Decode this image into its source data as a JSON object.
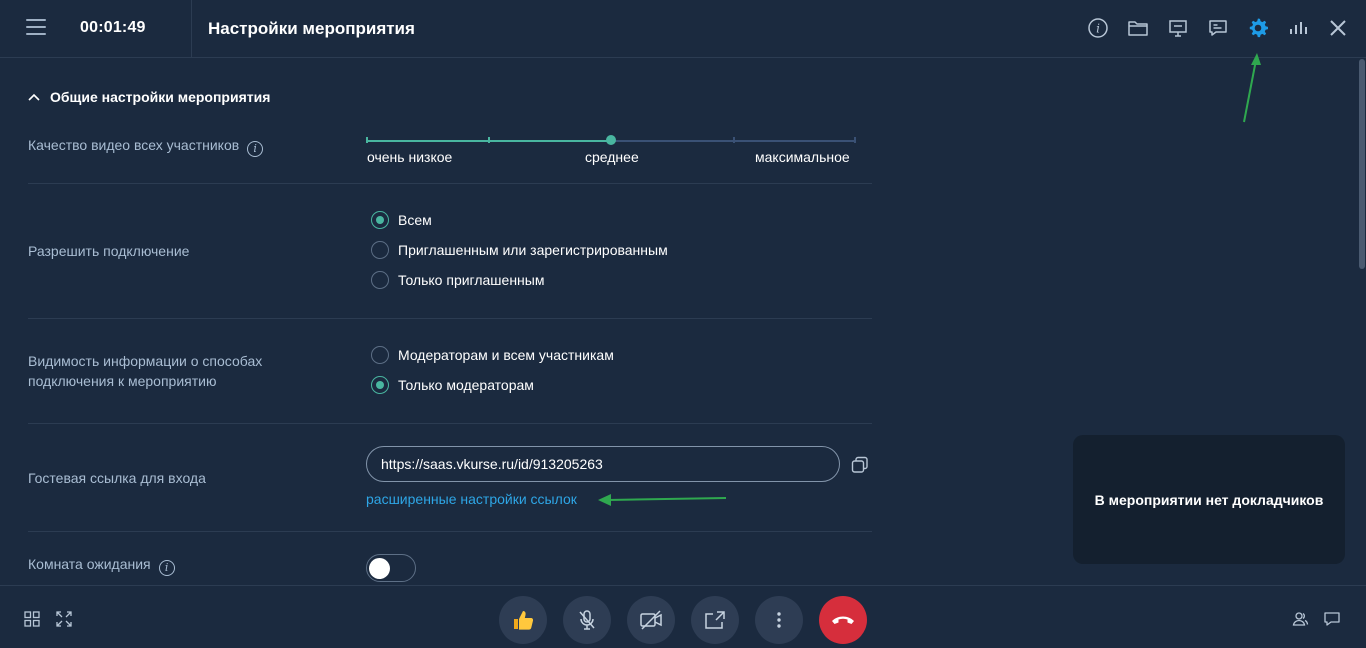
{
  "header": {
    "timer": "00:01:49",
    "title": "Настройки мероприятия",
    "tools": [
      "info-icon",
      "folder-icon",
      "presentation-icon",
      "chat-icon",
      "settings-gear-icon",
      "stats-icon",
      "close-icon"
    ],
    "active_tool_color": "#1e9be6"
  },
  "section": {
    "title": "Общие настройки мероприятия"
  },
  "video_quality": {
    "label": "Качество видео всех участников",
    "levels": [
      "очень низкое",
      "среднее",
      "максимальное"
    ],
    "current_level_fraction": 0.5
  },
  "allow_connection": {
    "label": "Разрешить подключение",
    "options": [
      {
        "label": "Всем",
        "selected": true
      },
      {
        "label": "Приглашенным или зарегистрированным",
        "selected": false
      },
      {
        "label": "Только приглашенным",
        "selected": false
      }
    ]
  },
  "visibility": {
    "label": "Видимость информации о способах подключения к мероприятию",
    "options": [
      {
        "label": "Модераторам и всем участникам",
        "selected": false
      },
      {
        "label": "Только модераторам",
        "selected": true
      }
    ]
  },
  "guest_link": {
    "label": "Гостевая ссылка для входа",
    "value": "https://saas.vkurse.ru/id/913205263",
    "advanced_link": "расширенные настройки ссылок"
  },
  "waiting_room": {
    "label": "Комната ожидания",
    "enabled": false
  },
  "speakers_panel": {
    "text": "В мероприятии нет докладчиков"
  },
  "bottom_bar": {
    "controls": [
      "thumbs-up-icon",
      "microphone-off-icon",
      "camera-off-icon",
      "share-screen-icon",
      "more-vertical-icon",
      "hang-up-icon"
    ]
  },
  "colors": {
    "background": "#1b2a3f",
    "accent_green": "#49b6a0",
    "link_blue": "#2ea6e6",
    "hangup_red": "#d62e3c",
    "annotation_arrow": "#2fa84f"
  }
}
